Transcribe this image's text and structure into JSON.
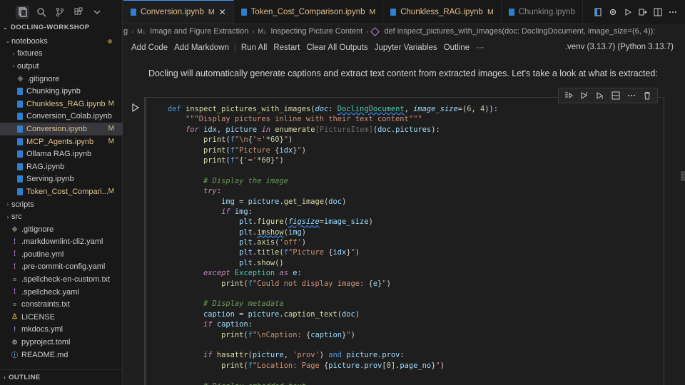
{
  "sidebar": {
    "title": "DOCLING-WORKSHOP",
    "outline_label": "OUTLINE",
    "items": [
      {
        "label": "notebooks",
        "kind": "folder-open",
        "indent": 1,
        "modified_dot": true
      },
      {
        "label": "fixtures",
        "kind": "folder",
        "indent": 2
      },
      {
        "label": "output",
        "kind": "folder",
        "indent": 2
      },
      {
        "label": ".gitignore",
        "kind": "git",
        "indent": 2
      },
      {
        "label": "Chunking.ipynb",
        "kind": "nb",
        "indent": 2
      },
      {
        "label": "Chunkless_RAG.ipynb",
        "kind": "nb",
        "indent": 2,
        "badge": "M"
      },
      {
        "label": "Conversion_Colab.ipynb",
        "kind": "nb",
        "indent": 2
      },
      {
        "label": "Conversion.ipynb",
        "kind": "nb",
        "indent": 2,
        "badge": "M",
        "selected": true
      },
      {
        "label": "MCP_Agents.ipynb",
        "kind": "nb",
        "indent": 2,
        "badge": "M"
      },
      {
        "label": "Ollama RAG.ipynb",
        "kind": "nb",
        "indent": 2
      },
      {
        "label": "RAG.ipynb",
        "kind": "nb",
        "indent": 2
      },
      {
        "label": "Serving.ipynb",
        "kind": "nb",
        "indent": 2
      },
      {
        "label": "Token_Cost_Compari...",
        "kind": "nb",
        "indent": 2,
        "badge": "M"
      },
      {
        "label": "scripts",
        "kind": "folder",
        "indent": 1
      },
      {
        "label": "src",
        "kind": "folder",
        "indent": 1
      },
      {
        "label": ".gitignore",
        "kind": "git",
        "indent": 1
      },
      {
        "label": ".markdownlint-cli2.yaml",
        "kind": "yaml",
        "indent": 1
      },
      {
        "label": ".poutine.yml",
        "kind": "yaml",
        "indent": 1
      },
      {
        "label": ".pre-commit-config.yaml",
        "kind": "yaml",
        "indent": 1
      },
      {
        "label": ".spellcheck-en-custom.txt",
        "kind": "txt",
        "indent": 1
      },
      {
        "label": ".spellcheck.yaml",
        "kind": "yaml",
        "indent": 1
      },
      {
        "label": "constraints.txt",
        "kind": "txt",
        "indent": 1
      },
      {
        "label": "LICENSE",
        "kind": "lic",
        "indent": 1
      },
      {
        "label": "mkdocs.yml",
        "kind": "yml",
        "indent": 1
      },
      {
        "label": "pyproject.toml",
        "kind": "toml",
        "indent": 1
      },
      {
        "label": "README.md",
        "kind": "md",
        "indent": 1
      }
    ]
  },
  "tabs": [
    {
      "label": "Conversion.ipynb",
      "status": "M",
      "active": true,
      "close": "✕"
    },
    {
      "label": "Token_Cost_Comparison.ipynb",
      "status": "M"
    },
    {
      "label": "Chunkless_RAG.ipynb",
      "status": "M"
    },
    {
      "label": "Chunking.ipynb",
      "status": "",
      "inactive": true
    }
  ],
  "breadcrumb": {
    "lead": "g",
    "items": [
      "Image and Figure Extraction",
      "Inspecting Picture Content",
      "def inspect_pictures_with_images(doc: DoclingDocument, image_size=(6, 4)):"
    ],
    "markers": [
      "M↓",
      "M↓",
      ""
    ]
  },
  "toolbar": {
    "add_code": "Add Code",
    "add_markdown": "Add Markdown",
    "run_all": "Run All",
    "restart": "Restart",
    "clear_outputs": "Clear All Outputs",
    "variables": "Jupyter Variables",
    "outline": "Outline",
    "more": "···",
    "kernel": ".venv (3.13.7) (Python 3.13.7)"
  },
  "markdown_text": "Docling will automatically generate captions and extract text content from extracted images. Let's take a look at what is extracted:",
  "code_lines": [
    "<span class='kw'>def</span> <span class='fn'>inspect_pictures_with_images</span>(<span class='pm'>doc</span>: <span class='ty sq'>DoclingDocument</span>, <span class='pm'>image_size</span>=(<span class='nm'>6</span>, <span class='nm'>4</span>)):",
    "    <span class='st'>\"\"\"Display pictures inline with their text content\"\"\"</span>",
    "    <span class='kwi'>for</span> <span class='vr'>idx</span>, <span class='vr'>picture</span> <span class='kwi'>in</span> <span class='fn'>enumerate</span><span class='dim'>[PictureItem]</span>(<span class='vr'>doc</span>.<span class='vr'>pictures</span>):",
    "        <span class='fn'>print</span>(<span class='kw'>f</span><span class='st'>\"\\n</span>{<span class='st'>'='</span>*<span class='nm'>60</span>}<span class='st'>\"</span>)",
    "        <span class='fn'>print</span>(<span class='kw'>f</span><span class='st'>\"Picture </span>{<span class='vr'>idx</span>}<span class='st'>\"</span>)",
    "        <span class='fn'>print</span>(<span class='kw'>f</span><span class='st'>\"</span>{<span class='st'>'='</span>*<span class='nm'>60</span>}<span class='st'>\"</span>)",
    "",
    "        <span class='cm'># Display the image</span>",
    "        <span class='kwi'>try</span>:",
    "            <span class='vr'>img</span> = <span class='vr'>picture</span>.<span class='fn'>get_image</span>(<span class='vr'>doc</span>)",
    "            <span class='kwi'>if</span> <span class='vr'>img</span>:",
    "                <span class='vr'>plt</span>.<span class='fn'>figure</span>(<span class='pm sq'>figsize</span>=<span class='vr'>image_size</span>)",
    "                <span class='vr'>plt</span>.<span class='fn sq'>imshow</span>(<span class='vr'>img</span>)",
    "                <span class='vr'>plt</span>.<span class='fn'>axis</span>(<span class='st'>'off'</span>)",
    "                <span class='vr'>plt</span>.<span class='fn'>title</span>(<span class='kw'>f</span><span class='st'>\"Picture </span>{<span class='vr'>idx</span>}<span class='st'>\"</span>)",
    "                <span class='vr'>plt</span>.<span class='fn'>show</span>()",
    "        <span class='kwi'>except</span> <span class='ty'>Exception</span> <span class='kwi'>as</span> <span class='vr'>e</span>:",
    "            <span class='fn'>print</span>(<span class='kw'>f</span><span class='st'>\"Could not display image: </span>{<span class='vr'>e</span>}<span class='st'>\"</span>)",
    "",
    "        <span class='cm'># Display metadata</span>",
    "        <span class='vr'>caption</span> = <span class='vr'>picture</span>.<span class='fn'>caption_text</span>(<span class='vr'>doc</span>)",
    "        <span class='kwi'>if</span> <span class='vr'>caption</span>:",
    "            <span class='fn'>print</span>(<span class='kw'>f</span><span class='st'>\"\\nCaption: </span>{<span class='vr'>caption</span>}<span class='st'>\"</span>)",
    "",
    "        <span class='kwi'>if</span> <span class='fn'>hasattr</span>(<span class='vr'>picture</span>, <span class='st'>'prov'</span>) <span class='kw'>and</span> <span class='vr'>picture</span>.<span class='vr'>prov</span>:",
    "            <span class='fn'>print</span>(<span class='kw'>f</span><span class='st'>\"Location: Page </span>{<span class='vr'>picture</span>.<span class='vr'>prov</span>[<span class='nm'>0</span>].<span class='vr'>page_no</span>}<span class='st'>\"</span>)",
    "",
    "        <span class='cm'># Display embedded text</span>"
  ],
  "colors": {
    "accent": "#3794ff",
    "modified": "#e2c08d",
    "background": "#1e1e1e",
    "sidebar": "#181818"
  }
}
